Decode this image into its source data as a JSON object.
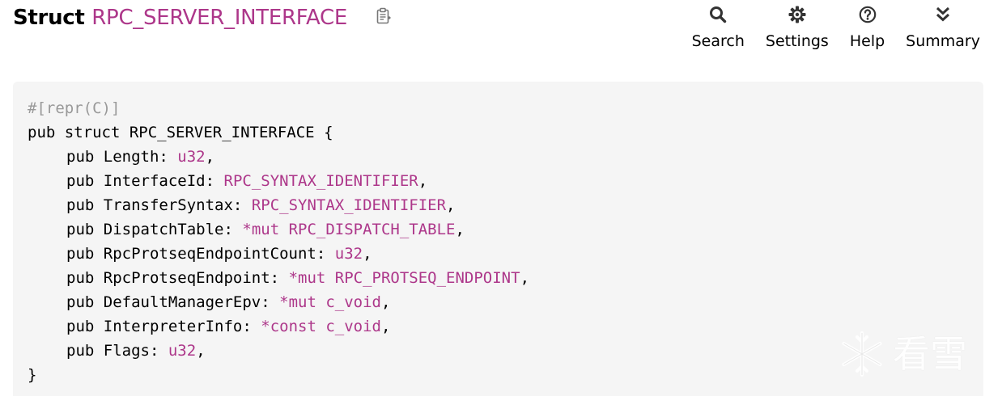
{
  "header": {
    "kind": "Struct",
    "name": "RPC_SERVER_INTERFACE",
    "copy_icon": "copy-path-icon"
  },
  "toolbar": {
    "search_label": "Search",
    "settings_label": "Settings",
    "help_label": "Help",
    "summary_label": "Summary"
  },
  "code": {
    "attribute": "#[repr(C)]",
    "decl_kw": "pub struct",
    "struct_name": "RPC_SERVER_INTERFACE",
    "open_brace": "{",
    "close_brace": "}",
    "fields": [
      {
        "name": "Length",
        "ptr": "",
        "type": "u32"
      },
      {
        "name": "InterfaceId",
        "ptr": "",
        "type": "RPC_SYNTAX_IDENTIFIER"
      },
      {
        "name": "TransferSyntax",
        "ptr": "",
        "type": "RPC_SYNTAX_IDENTIFIER"
      },
      {
        "name": "DispatchTable",
        "ptr": "*mut",
        "type": "RPC_DISPATCH_TABLE"
      },
      {
        "name": "RpcProtseqEndpointCount",
        "ptr": "",
        "type": "u32"
      },
      {
        "name": "RpcProtseqEndpoint",
        "ptr": "*mut",
        "type": "RPC_PROTSEQ_ENDPOINT"
      },
      {
        "name": "DefaultManagerEpv",
        "ptr": "*mut",
        "type": "c_void"
      },
      {
        "name": "InterpreterInfo",
        "ptr": "*const",
        "type": "c_void"
      },
      {
        "name": "Flags",
        "ptr": "",
        "type": "u32"
      }
    ]
  },
  "watermark": {
    "text": "看雪",
    "icon": "snowflake-icon"
  },
  "colors": {
    "type_accent": "#ad378a",
    "attribute_gray": "#999999",
    "code_background": "#f5f5f5"
  }
}
